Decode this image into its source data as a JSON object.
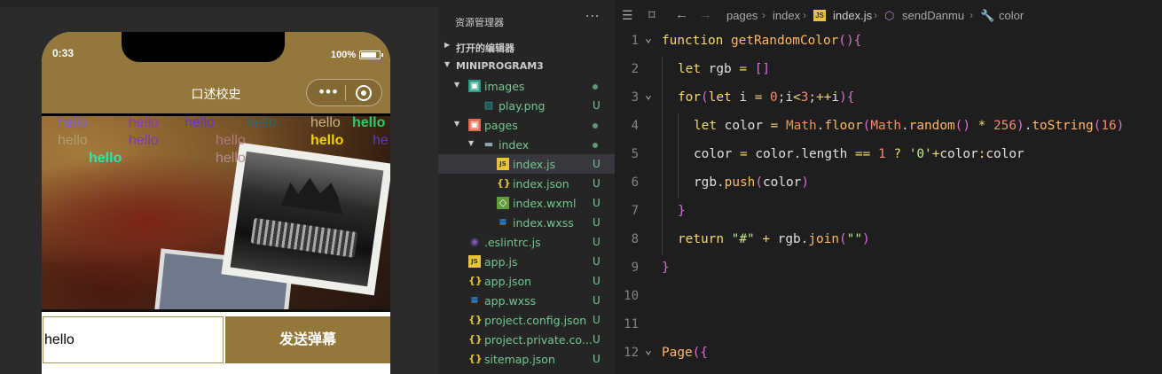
{
  "simulator": {
    "status_time": "0:33",
    "battery_text": "100%",
    "nav_title": "口述校史",
    "capsule_more": "•••",
    "danmu": [
      {
        "text": "hello",
        "color": "#7a5fc8"
      },
      {
        "text": "hello",
        "color": "#8a3fb0"
      },
      {
        "text": "hello",
        "color": "#6a2fe0"
      },
      {
        "text": "hello",
        "color": "#2a6a70"
      },
      {
        "text": "hello",
        "color": "#c8b880"
      },
      {
        "text": "hello",
        "color": "#29d06a"
      },
      {
        "text": "hello",
        "color": "#b0a070"
      },
      {
        "text": "hello",
        "color": "#7a3fa8"
      },
      {
        "text": "hello",
        "color": "#b07a80"
      },
      {
        "text": "hello",
        "color": "#f0d400"
      },
      {
        "text": "he",
        "color": "#5a3fa8"
      },
      {
        "text": "hello",
        "color": "#2ee6b0"
      },
      {
        "text": "hello",
        "color": "#b09090"
      }
    ],
    "input_value": "hello",
    "send_button": "发送弹幕"
  },
  "explorer": {
    "title": "资源管理器",
    "menu": "···",
    "open_editors": "打开的编辑器",
    "project": "MINIPROGRAM3",
    "items": [
      {
        "name": "images",
        "icon": "folder-images-icon",
        "badge": "",
        "dot": true,
        "level": 1,
        "folder": true
      },
      {
        "name": "play.png",
        "icon": "image-file-icon",
        "badge": "U",
        "dot": false,
        "level": 2,
        "folder": false
      },
      {
        "name": "pages",
        "icon": "folder-pages-icon",
        "badge": "",
        "dot": true,
        "level": 1,
        "folder": true
      },
      {
        "name": "index",
        "icon": "folder-icon",
        "badge": "",
        "dot": true,
        "level": 2,
        "folder": true
      },
      {
        "name": "index.js",
        "icon": "js-file-icon",
        "badge": "U",
        "dot": false,
        "level": 3,
        "folder": false,
        "active": true
      },
      {
        "name": "index.json",
        "icon": "json-file-icon",
        "badge": "U",
        "dot": false,
        "level": 3,
        "folder": false
      },
      {
        "name": "index.wxml",
        "icon": "wxml-file-icon",
        "badge": "U",
        "dot": false,
        "level": 3,
        "folder": false
      },
      {
        "name": "index.wxss",
        "icon": "css-file-icon",
        "badge": "U",
        "dot": false,
        "level": 3,
        "folder": false
      },
      {
        "name": ".eslintrc.js",
        "icon": "eslint-file-icon",
        "badge": "U",
        "dot": false,
        "level": 1,
        "folder": false
      },
      {
        "name": "app.js",
        "icon": "js-file-icon",
        "badge": "U",
        "dot": false,
        "level": 1,
        "folder": false
      },
      {
        "name": "app.json",
        "icon": "json-file-icon",
        "badge": "U",
        "dot": false,
        "level": 1,
        "folder": false
      },
      {
        "name": "app.wxss",
        "icon": "css-file-icon",
        "badge": "U",
        "dot": false,
        "level": 1,
        "folder": false
      },
      {
        "name": "project.config.json",
        "icon": "json-file-icon",
        "badge": "U",
        "dot": false,
        "level": 1,
        "folder": false
      },
      {
        "name": "project.private.co...",
        "icon": "json-file-icon",
        "badge": "U",
        "dot": false,
        "level": 1,
        "folder": false
      },
      {
        "name": "sitemap.json",
        "icon": "json-file-icon",
        "badge": "U",
        "dot": false,
        "level": 1,
        "folder": false
      }
    ]
  },
  "editor": {
    "breadcrumbs": [
      "pages",
      "index",
      "index.js",
      "sendDanmu",
      "color"
    ],
    "line_numbers": [
      "1",
      "2",
      "3",
      "4",
      "5",
      "6",
      "7",
      "8",
      "9",
      "10",
      "11",
      "12"
    ],
    "lines": [
      "function getRandomColor(){",
      "let rgb = []",
      "for(let i = 0;i<3;++i){",
      "let color = Math.floor(Math.random() * 256).toString(16)",
      "color = color.length == 1 ? '0'+color:color",
      "rgb.push(color)",
      "}",
      "return \"#\" + rgb.join(\"\")",
      "}",
      "",
      "",
      "Page({"
    ]
  }
}
